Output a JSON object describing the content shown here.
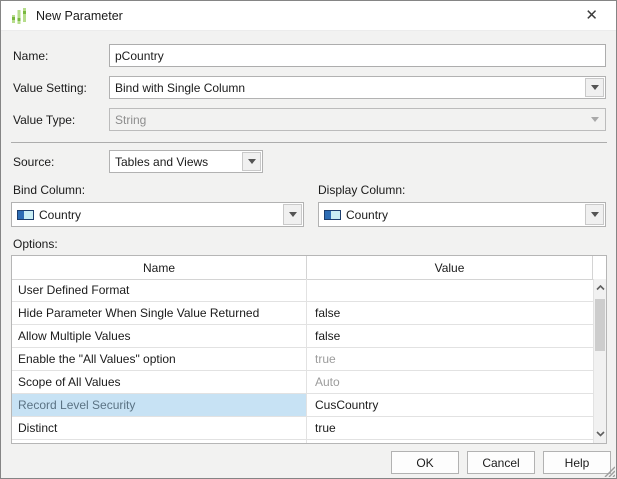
{
  "dialog": {
    "title": "New Parameter",
    "close_glyph": "✕"
  },
  "fields": {
    "name": {
      "label": "Name:",
      "value": "pCountry"
    },
    "value_setting": {
      "label": "Value Setting:",
      "value": "Bind with Single Column"
    },
    "value_type": {
      "label": "Value Type:",
      "value": "String"
    },
    "source": {
      "label": "Source:",
      "value": "Tables and Views"
    },
    "bind_column": {
      "label": "Bind Column:",
      "value": "Country"
    },
    "display_column": {
      "label": "Display Column:",
      "value": "Country"
    }
  },
  "options": {
    "label": "Options:",
    "columns": [
      "Name",
      "Value"
    ],
    "rows": [
      {
        "name": "User Defined Format",
        "value": ""
      },
      {
        "name": "Hide Parameter When Single Value Returned",
        "value": "false"
      },
      {
        "name": "Allow Multiple Values",
        "value": "false"
      },
      {
        "name": "Enable the \"All Values\" option",
        "value": "true"
      },
      {
        "name": "Scope of All Values",
        "value": "Auto"
      },
      {
        "name": "Record Level Security",
        "value": "CusCountry"
      },
      {
        "name": "Distinct",
        "value": "true"
      }
    ]
  },
  "buttons": {
    "ok": "OK",
    "cancel": "Cancel",
    "help": "Help"
  },
  "colors": {
    "selected_row_bg": "#c7e2f4",
    "selected_row_text": "#5b7384",
    "muted_value_text": "#9c9c9c",
    "icon_green": "#8cc152",
    "column_icon_blue": "#2d6db5",
    "column_icon_cyan": "#c9eef5"
  }
}
